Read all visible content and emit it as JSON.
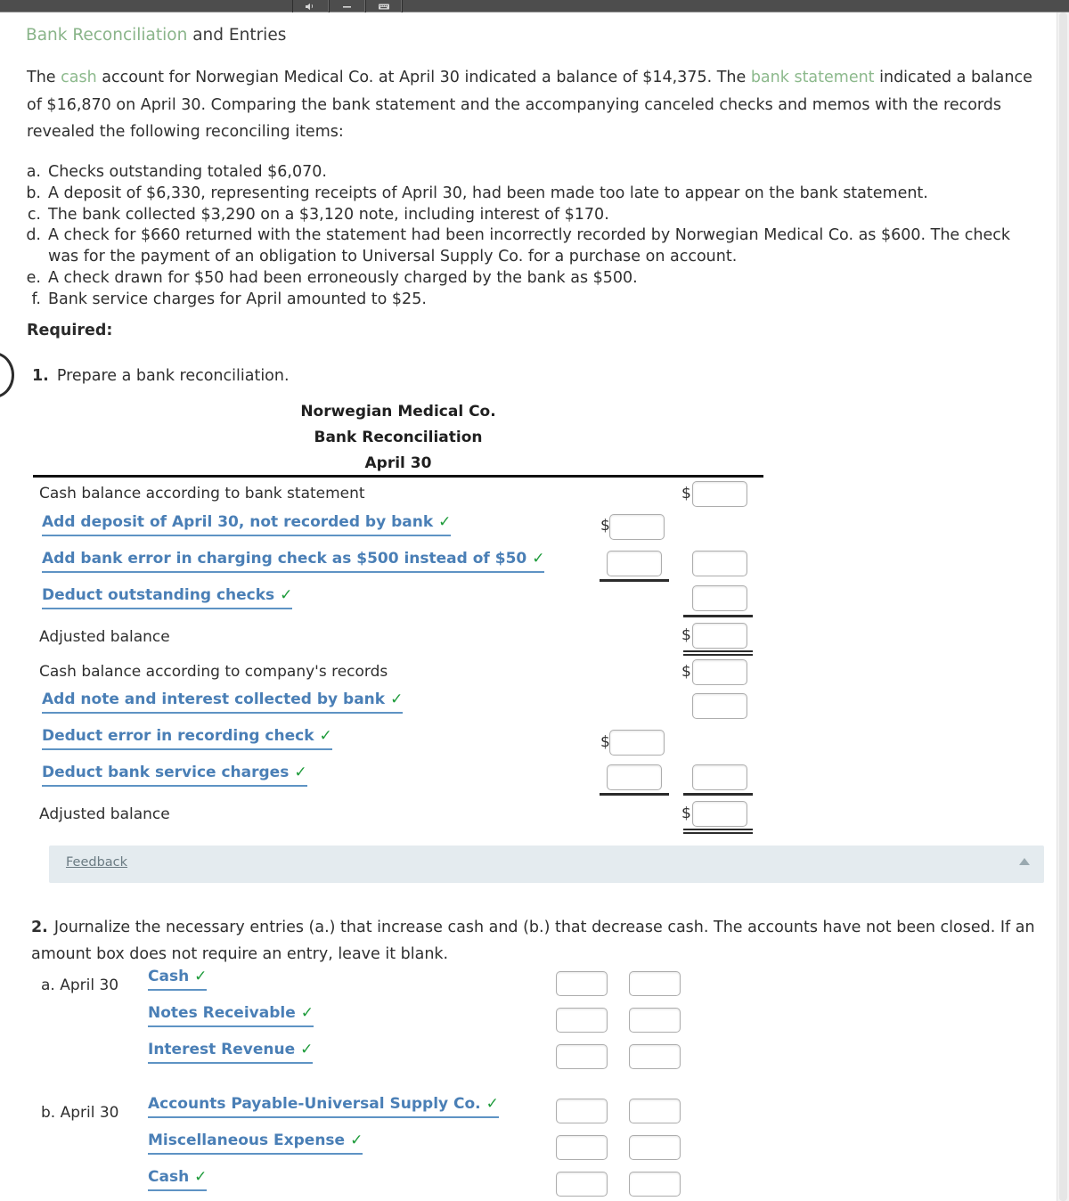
{
  "toolbar": {
    "buttons": [
      {
        "name": "speaker-icon",
        "label": "Speaker"
      },
      {
        "name": "minus-icon",
        "label": "Minus"
      },
      {
        "name": "keyboard-icon",
        "label": "Keyboard"
      }
    ]
  },
  "question": {
    "title_link": "Bank Reconciliation",
    "title_rest": " and Entries",
    "paragraph": {
      "p1": "The ",
      "link": "cash",
      "p2": " account for Norwegian Medical Co. at April 30 indicated a balance of $14,375. The ",
      "link2": "bank statement",
      "p3": " indicated a balance of $16,870 on April 30. Comparing the bank statement and the accompanying canceled checks and memos with the records revealed the following reconciling items:"
    },
    "items": [
      {
        "marker": "a.",
        "text": "Checks outstanding totaled $6,070."
      },
      {
        "marker": "b.",
        "text": "A deposit of $6,330, representing receipts of April 30, had been made too late to appear on the bank statement."
      },
      {
        "marker": "c.",
        "text": "The bank collected $3,290 on a $3,120 note, including interest of $170."
      },
      {
        "marker": "d.",
        "text": "A check for $660 returned with the statement had been incorrectly recorded by Norwegian Medical Co. as $600. The check was for the payment of an obligation to Universal Supply Co. for a purchase on account."
      },
      {
        "marker": "e.",
        "text": "A check drawn for $50 had been erroneously charged by the bank as $500."
      },
      {
        "marker": "f.",
        "text": "Bank service charges for April amounted to $25."
      }
    ],
    "required_label": "Required:",
    "req1_number": "1.",
    "req1_text": "Prepare a bank reconciliation."
  },
  "statement": {
    "company": "Norwegian Medical Co.",
    "title": "Bank Reconciliation",
    "date": "April 30",
    "rows": [
      {
        "label": "Cash balance according to bank statement",
        "style": "plain"
      },
      {
        "label": "Add deposit of April 30, not recorded by bank",
        "style": "link"
      },
      {
        "label": "Add bank error in charging check as $500 instead of $50",
        "style": "link"
      },
      {
        "label": "Deduct outstanding checks",
        "style": "link"
      },
      {
        "label": "Adjusted balance",
        "style": "plain"
      },
      {
        "label": "Cash balance according to company's records",
        "style": "plain"
      },
      {
        "label": "Add note and interest collected by bank",
        "style": "link"
      },
      {
        "label": "Deduct error in recording check",
        "style": "link"
      },
      {
        "label": "Deduct bank service charges",
        "style": "link"
      },
      {
        "label": "Adjusted balance",
        "style": "plain"
      }
    ],
    "dollar_sign": "$",
    "check_glyph": "✓"
  },
  "feedback": {
    "link": "Feedback"
  },
  "part2": {
    "number": "2.",
    "text": "Journalize the necessary entries (a.) that increase cash and (b.) that decrease cash. The accounts have not been closed. If an amount box does not require an entry, leave it blank.",
    "entries": [
      {
        "date": "a. April 30",
        "accounts": [
          "Cash",
          "Notes Receivable",
          "Interest Revenue"
        ]
      },
      {
        "date": "b. April 30",
        "accounts": [
          "Accounts Payable-Universal Supply Co.",
          "Miscellaneous Expense",
          "Cash"
        ]
      }
    ],
    "check_glyph": "✓"
  },
  "colors": {
    "link_green": "#89b489",
    "account_blue": "#4a7fb6",
    "check_green": "#1d9b3a",
    "feedback_bg": "#e4ebef",
    "toolbar_bg": "#4d4d4d"
  }
}
